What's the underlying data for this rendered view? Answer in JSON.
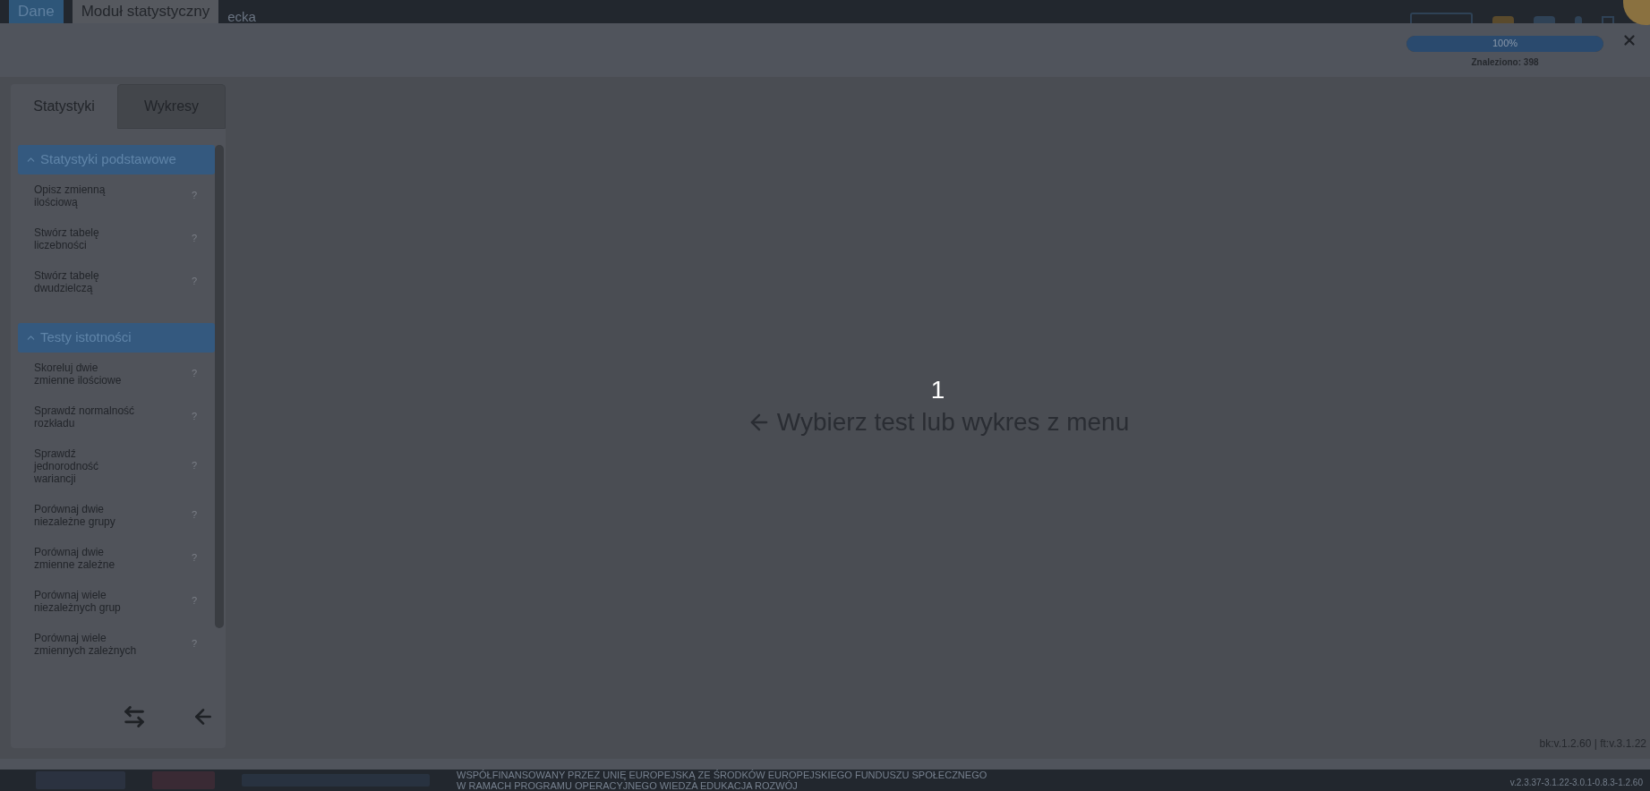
{
  "app_tabs": [
    {
      "label": "Dane",
      "selected": false
    },
    {
      "label": "Moduł statystyczny",
      "selected": true
    }
  ],
  "background_fragment": "ecka",
  "progress": {
    "level": 1,
    "label": "100%",
    "found": "Znaleziono: 398"
  },
  "sidebar": {
    "tabs": [
      {
        "label": "Statystyki",
        "selected": true
      },
      {
        "label": "Wykresy",
        "selected": false
      }
    ],
    "sections": [
      {
        "title": "Statystyki podstawowe",
        "expanded": true,
        "items": [
          {
            "label": "Opisz zmienną ilościową",
            "help": "?"
          },
          {
            "label": "Stwórz tabelę liczebności",
            "help": "?"
          },
          {
            "label": "Stwórz tabelę dwudzielczą",
            "help": "?"
          }
        ]
      },
      {
        "title": "Testy istotności",
        "expanded": true,
        "items": [
          {
            "label": "Skoreluj dwie zmienne ilościowe",
            "help": "?"
          },
          {
            "label": "Sprawdź normalność rozkładu",
            "help": "?"
          },
          {
            "label": "Sprawdź jednorodność wariancji",
            "help": "?"
          },
          {
            "label": "Porównaj dwie niezależne grupy",
            "help": "?"
          },
          {
            "label": "Porównaj dwie zmienne zależne",
            "help": "?"
          },
          {
            "label": "Porównaj wiele niezależnych grup",
            "help": "?"
          },
          {
            "label": "Porównaj wiele zmiennych zależnych",
            "help": "?"
          }
        ]
      }
    ]
  },
  "main": {
    "step": "1",
    "prompt": "Wybierz test lub wykres z menu"
  },
  "versions": "bk:v.1.2.60 | ft:v.3.1.22",
  "footer": {
    "lines": [
      "WSPÓŁFINANSOWANY PRZEZ UNIĘ EUROPEJSKĄ ZE ŚRODKÓW EUROPEJSKIEGO FUNDUSZU SPOŁECZNEGO",
      "W RAMACH PROGRAMU OPERACYJNEGO WIEDZA EDUKACJA ROZWÓJ"
    ],
    "version": "v.2.3.37-3.1.22-3.0.1-0.8.3-1.2.60"
  }
}
